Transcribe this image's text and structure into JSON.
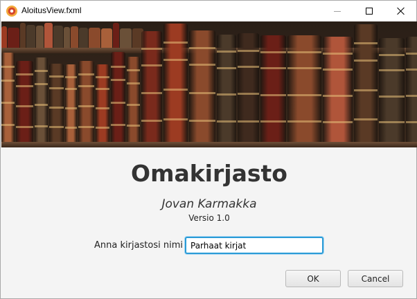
{
  "window": {
    "title": "AloitusView.fxml",
    "icon": "app-icon"
  },
  "banner": {
    "image": "bookshelf-banner"
  },
  "main": {
    "title": "Omakirjasto",
    "author": "Jovan Karmakka",
    "version": "Versio 1.0",
    "name_label": "Anna kirjastosi nimi",
    "name_value": "Parhaat kirjat"
  },
  "buttons": {
    "ok_label": "OK",
    "cancel_label": "Cancel"
  },
  "colors": {
    "focus_border": "#2a9bd6",
    "title_text": "#333333"
  }
}
